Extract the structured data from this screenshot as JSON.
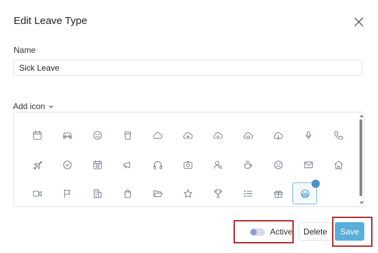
{
  "dialog": {
    "title": "Edit Leave Type",
    "name_label": "Name",
    "name_value": "Sick Leave",
    "add_icon_label": "Add icon"
  },
  "icons": [
    "calendar-icon",
    "car-icon",
    "smile-icon",
    "cup-icon",
    "cloud-icon",
    "cloud-upload-icon",
    "cloud-sync-icon",
    "cloud-plus-icon",
    "cloud-download-icon",
    "microphone-icon",
    "phone-icon",
    "airplane-icon",
    "check-circle-icon",
    "calendar-badge-icon",
    "megaphone-icon",
    "headphones-icon",
    "camera-icon",
    "user-search-icon",
    "coffee-icon",
    "sad-face-icon",
    "mail-icon",
    "home-icon",
    "video-icon",
    "flag-icon",
    "building-icon",
    "shopping-bag-icon",
    "folder-open-icon",
    "star-icon",
    "trophy-icon",
    "list-icon",
    "gift-icon",
    "face-mask-icon"
  ],
  "selected_icon": "face-mask-icon",
  "footer": {
    "active_label": "Active",
    "active_on": false,
    "delete_label": "Delete",
    "save_label": "Save"
  },
  "colors": {
    "accent": "#5aaed9",
    "highlight_box": "#b02a2a",
    "selected_border": "#7fb5e6"
  }
}
